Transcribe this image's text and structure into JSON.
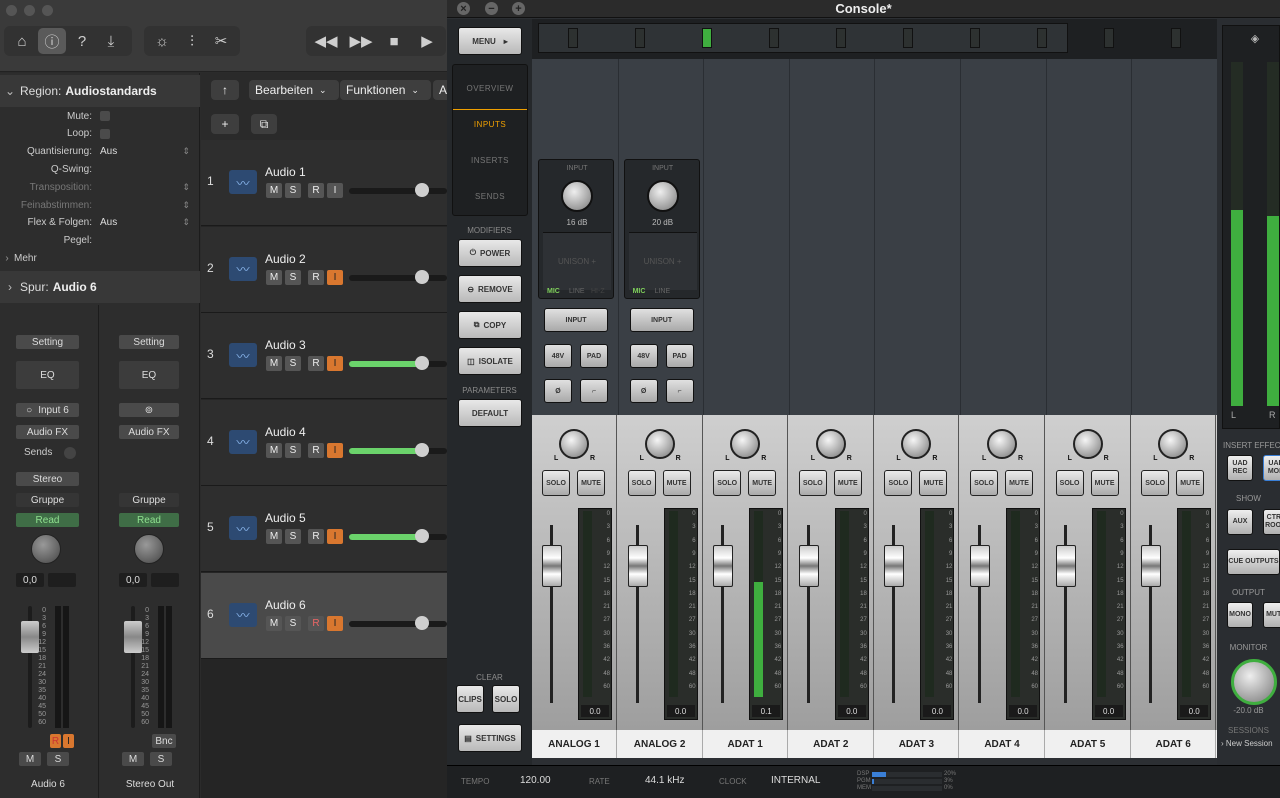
{
  "logic": {
    "region_header_prefix": "Region:",
    "region_name": "Audiostandards",
    "properties": [
      {
        "key": "Mute:",
        "value": "",
        "dim": false,
        "checkbox": true
      },
      {
        "key": "Loop:",
        "value": "",
        "dim": false,
        "checkbox": true
      },
      {
        "key": "Quantisierung:",
        "value": "Aus",
        "dim": false,
        "checkbox": false
      },
      {
        "key": "Q-Swing:",
        "value": "",
        "dim": false,
        "checkbox": false
      },
      {
        "key": "Transposition:",
        "value": "",
        "dim": true,
        "checkbox": false
      },
      {
        "key": "Feinabstimmen:",
        "value": "",
        "dim": true,
        "checkbox": false
      },
      {
        "key": "Flex & Folgen:",
        "value": "Aus",
        "dim": false,
        "checkbox": false
      },
      {
        "key": "Pegel:",
        "value": "",
        "dim": false,
        "checkbox": false
      }
    ],
    "more_label": "Mehr",
    "track_header_prefix": "Spur:",
    "track_name": "Audio 6",
    "strips": [
      {
        "setting": "Setting",
        "eq": "EQ",
        "input": "Input 6",
        "fx": "Audio FX",
        "sends": "Sends",
        "output": "Stereo",
        "group": "Gruppe",
        "automation": "Read",
        "value": "0,0",
        "m": "M",
        "s": "S",
        "name": "Audio 6",
        "ri_r": "R",
        "ri_i": "I"
      },
      {
        "setting": "Setting",
        "eq": "EQ",
        "input": "",
        "fx": "Audio FX",
        "sends": "",
        "output": "",
        "group": "Gruppe",
        "automation": "Read",
        "value": "0,0",
        "m": "M",
        "s": "S",
        "name": "Stereo Out",
        "bnc": "Bnc"
      }
    ],
    "strip_scale": [
      "0",
      "3",
      "6",
      "9",
      "12",
      "15",
      "18",
      "21",
      "24",
      "30",
      "35",
      "40",
      "45",
      "50",
      "60"
    ],
    "tracklist_toolbar": {
      "edit": "Bearbeiten",
      "functions": "Funktionen",
      "more": "A"
    },
    "tracks": [
      {
        "num": "1",
        "name": "Audio 1",
        "m": "M",
        "s": "S",
        "r": "R",
        "i": "I",
        "input_on": false,
        "volume": 0.74,
        "selected": false
      },
      {
        "num": "2",
        "name": "Audio 2",
        "m": "M",
        "s": "S",
        "r": "R",
        "i": "I",
        "input_on": true,
        "volume": 0.74,
        "selected": false
      },
      {
        "num": "3",
        "name": "Audio 3",
        "m": "M",
        "s": "S",
        "r": "R",
        "i": "I",
        "input_on": true,
        "volume": 0.74,
        "selected": false
      },
      {
        "num": "4",
        "name": "Audio 4",
        "m": "M",
        "s": "S",
        "r": "R",
        "i": "I",
        "input_on": true,
        "volume": 0.74,
        "selected": false
      },
      {
        "num": "5",
        "name": "Audio 5",
        "m": "M",
        "s": "S",
        "r": "R",
        "i": "I",
        "input_on": true,
        "volume": 0.74,
        "selected": false
      },
      {
        "num": "6",
        "name": "Audio 6",
        "m": "M",
        "s": "S",
        "r": "R",
        "i": "I",
        "input_on": true,
        "volume": 0.74,
        "selected": true
      }
    ]
  },
  "console": {
    "title": "Console*",
    "menu": "MENU",
    "tabs": [
      "OVERVIEW",
      "INPUTS",
      "INSERTS",
      "SENDS"
    ],
    "active_tab": "INPUTS",
    "modifiers_label": "MODIFIERS",
    "modifiers": [
      "POWER",
      "REMOVE",
      "COPY",
      "ISOLATE"
    ],
    "parameters_label": "PARAMETERS",
    "default_label": "DEFAULT",
    "clear_label": "CLEAR",
    "clear_buttons": [
      "CLIPS",
      "SOLO"
    ],
    "settings_label": "SETTINGS",
    "input_modules": [
      {
        "label": "INPUT",
        "gain": "16 dB",
        "unison": "UNISON +",
        "mic": "MIC",
        "line": "LINE",
        "hiz": "HI-Z"
      },
      {
        "label": "INPUT",
        "gain": "20 dB",
        "unison": "UNISON +",
        "mic": "MIC",
        "line": "LINE",
        "hiz": ""
      }
    ],
    "input_buttons": {
      "input": "INPUT",
      "v48": "48V",
      "pad": "PAD",
      "phase": "Ø",
      "hpf": "⌐"
    },
    "channels": [
      {
        "name": "ANALOG 1",
        "solo": "SOLO",
        "mute": "MUTE",
        "readout": "0.0",
        "level": 0.0
      },
      {
        "name": "ANALOG 2",
        "solo": "SOLO",
        "mute": "MUTE",
        "readout": "0.0",
        "level": 0.0
      },
      {
        "name": "ADAT 1",
        "solo": "SOLO",
        "mute": "MUTE",
        "readout": "0.1",
        "level": 0.62
      },
      {
        "name": "ADAT 2",
        "solo": "SOLO",
        "mute": "MUTE",
        "readout": "0.0",
        "level": 0.0
      },
      {
        "name": "ADAT 3",
        "solo": "SOLO",
        "mute": "MUTE",
        "readout": "0.0",
        "level": 0.0
      },
      {
        "name": "ADAT 4",
        "solo": "SOLO",
        "mute": "MUTE",
        "readout": "0.0",
        "level": 0.0
      },
      {
        "name": "ADAT 5",
        "solo": "SOLO",
        "mute": "MUTE",
        "readout": "0.0",
        "level": 0.0
      },
      {
        "name": "ADAT 6",
        "solo": "SOLO",
        "mute": "MUTE",
        "readout": "0.0",
        "level": 0.0
      }
    ],
    "fader_scale": [
      "12",
      "6",
      "0",
      "6",
      "12",
      "20",
      "32",
      "56",
      "∞"
    ],
    "meter_scale": [
      "0",
      "3",
      "6",
      "9",
      "12",
      "15",
      "18",
      "21",
      "27",
      "30",
      "36",
      "42",
      "48",
      "60"
    ],
    "pan_l": "L",
    "pan_r": "R",
    "scroller_active_index": 2,
    "right_panel": {
      "insert_effects": "INSERT EFFECTS",
      "uad_rec": "UAD REC",
      "uad_mon": "UAD MON",
      "show": "SHOW",
      "aux": "AUX",
      "ctrl_room": "CTRL ROOM",
      "cue_outputs": "CUE OUTPUTS",
      "output": "OUTPUT",
      "mono": "MONO",
      "mute": "MUTE",
      "monitor": "MONITOR",
      "monitor_value": "-20.0 dB",
      "sessions": "SESSIONS",
      "new_session": "New Session",
      "meter_l": "L",
      "meter_r": "R"
    },
    "status": {
      "tempo_label": "TEMPO",
      "tempo": "120.00",
      "rate_label": "RATE",
      "rate": "44.1 kHz",
      "clock_label": "CLOCK",
      "clock": "INTERNAL",
      "dsp_label": "DSP",
      "pgm_label": "PGM",
      "mem_label": "MEM",
      "dsp": "20%",
      "pgm": "3%",
      "mem": "0%"
    }
  },
  "colors": {
    "accent_orange": "#d9772f",
    "meter_green": "#3fae3f",
    "active_tab": "#f0a000",
    "read_green": "#8fe08f"
  }
}
